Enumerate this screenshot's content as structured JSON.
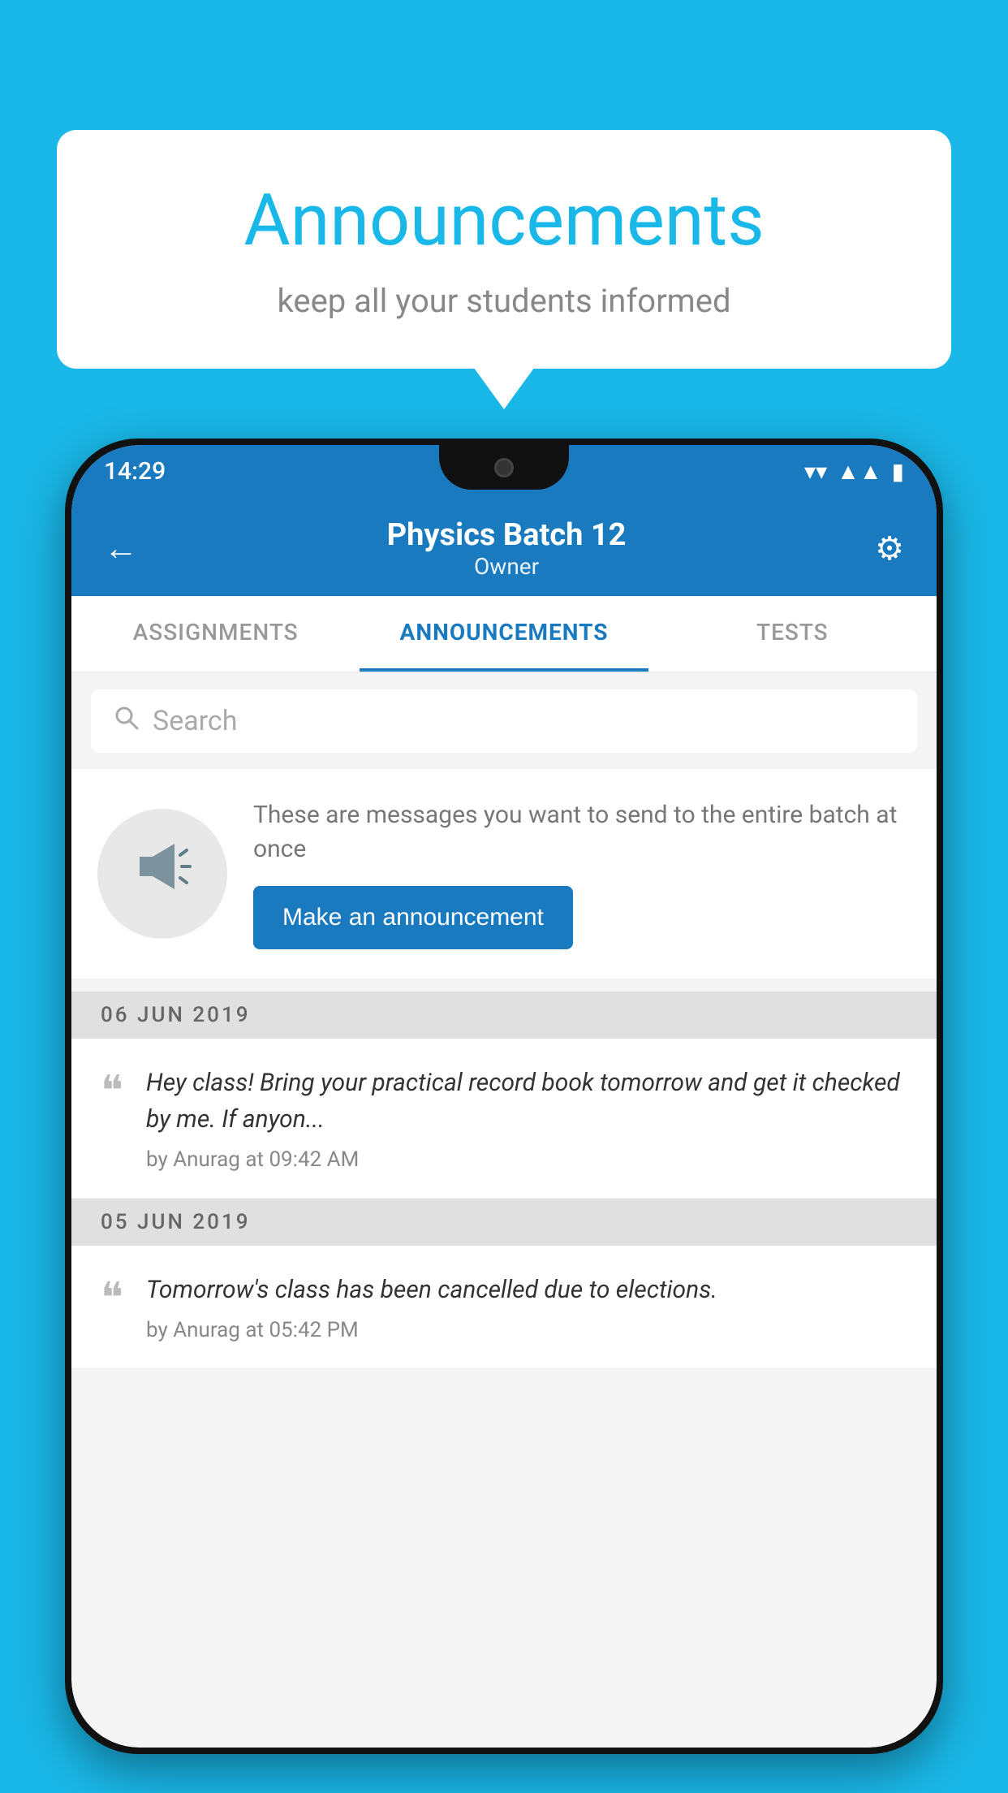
{
  "background_color": "#1ab8e8",
  "bubble": {
    "title": "Announcements",
    "subtitle": "keep all your students informed"
  },
  "phone": {
    "status_bar": {
      "time": "14:29"
    },
    "header": {
      "title": "Physics Batch 12",
      "subtitle": "Owner",
      "back_label": "←",
      "settings_label": "⚙"
    },
    "tabs": [
      {
        "label": "ASSIGNMENTS",
        "active": false
      },
      {
        "label": "ANNOUNCEMENTS",
        "active": true
      },
      {
        "label": "TESTS",
        "active": false
      }
    ],
    "search": {
      "placeholder": "Search"
    },
    "promo": {
      "description": "These are messages you want to send to the entire batch at once",
      "button_label": "Make an announcement"
    },
    "announcements": [
      {
        "date": "06  JUN  2019",
        "text": "Hey class! Bring your practical record book tomorrow and get it checked by me. If anyon...",
        "meta": "by Anurag at 09:42 AM"
      },
      {
        "date": "05  JUN  2019",
        "text": "Tomorrow's class has been cancelled due to elections.",
        "meta": "by Anurag at 05:42 PM"
      }
    ]
  }
}
